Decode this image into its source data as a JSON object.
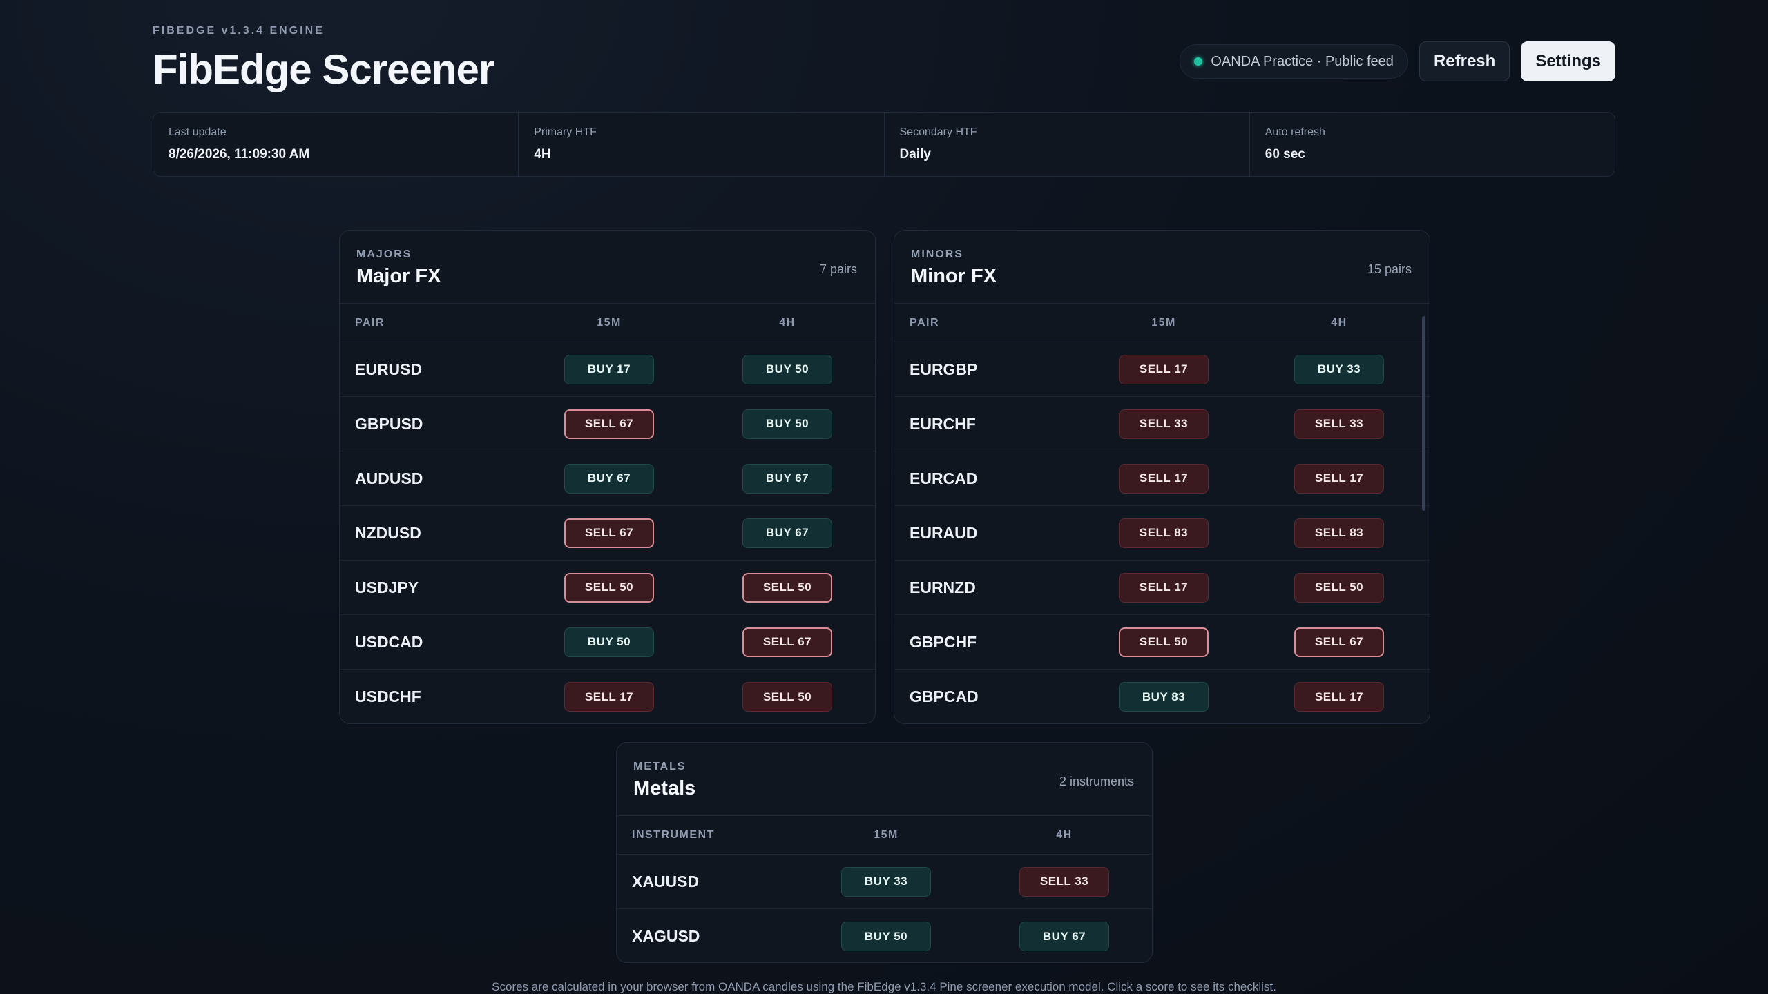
{
  "header": {
    "eyebrow": "FIBEDGE v1.3.4 ENGINE",
    "title": "FibEdge Screener",
    "feed_label": "OANDA Practice · Public feed",
    "refresh_label": "Refresh",
    "settings_label": "Settings"
  },
  "stats": [
    {
      "label": "Last update",
      "value": "8/26/2026, 11:09:30 AM"
    },
    {
      "label": "Primary HTF",
      "value": "4H"
    },
    {
      "label": "Secondary HTF",
      "value": "Daily"
    },
    {
      "label": "Auto refresh",
      "value": "60 sec"
    }
  ],
  "panels": {
    "majors": {
      "eyebrow": "MAJORS",
      "title": "Major FX",
      "count": "7 pairs",
      "columns": [
        "PAIR",
        "15M",
        "4H"
      ],
      "rows": [
        {
          "pair": "EURUSD",
          "m15": "BUY 17",
          "h4": "BUY 50"
        },
        {
          "pair": "GBPUSD",
          "m15": "SELL 67",
          "h4": "BUY 50"
        },
        {
          "pair": "AUDUSD",
          "m15": "BUY 67",
          "h4": "BUY 67"
        },
        {
          "pair": "NZDUSD",
          "m15": "SELL 67",
          "h4": "BUY 67"
        },
        {
          "pair": "USDJPY",
          "m15": "SELL 50",
          "h4": "SELL 50"
        },
        {
          "pair": "USDCAD",
          "m15": "BUY 50",
          "h4": "SELL 67"
        },
        {
          "pair": "USDCHF",
          "m15": "SELL 17",
          "h4": "SELL 50"
        }
      ]
    },
    "minors": {
      "eyebrow": "MINORS",
      "title": "Minor FX",
      "count": "15 pairs",
      "columns": [
        "PAIR",
        "15M",
        "4H"
      ],
      "rows": [
        {
          "pair": "EURGBP",
          "m15": "SELL 17",
          "h4": "BUY 33"
        },
        {
          "pair": "EURCHF",
          "m15": "SELL 33",
          "h4": "SELL 33"
        },
        {
          "pair": "EURCAD",
          "m15": "SELL 17",
          "h4": "SELL 17"
        },
        {
          "pair": "EURAUD",
          "m15": "SELL 83",
          "h4": "SELL 83"
        },
        {
          "pair": "EURNZD",
          "m15": "SELL 17",
          "h4": "SELL 50"
        },
        {
          "pair": "GBPCHF",
          "m15": "SELL 50",
          "h4": "SELL 67"
        },
        {
          "pair": "GBPCAD",
          "m15": "BUY 83",
          "h4": "SELL 17"
        }
      ]
    },
    "metals": {
      "eyebrow": "METALS",
      "title": "Metals",
      "count": "2 instruments",
      "columns": [
        "INSTRUMENT",
        "15M",
        "4H"
      ],
      "rows": [
        {
          "pair": "XAUUSD",
          "m15": "BUY 33",
          "h4": "SELL 33"
        },
        {
          "pair": "XAGUSD",
          "m15": "BUY 50",
          "h4": "BUY 67"
        }
      ]
    }
  },
  "footer": "Scores are calculated in your browser from OANDA candles using the FibEdge v1.3.4 Pine screener execution model. Click a score to see its checklist.",
  "colors": {
    "accent_buy": "#123033",
    "accent_sell": "#3a1a1f",
    "feed_dot": "#1ec4a0"
  }
}
